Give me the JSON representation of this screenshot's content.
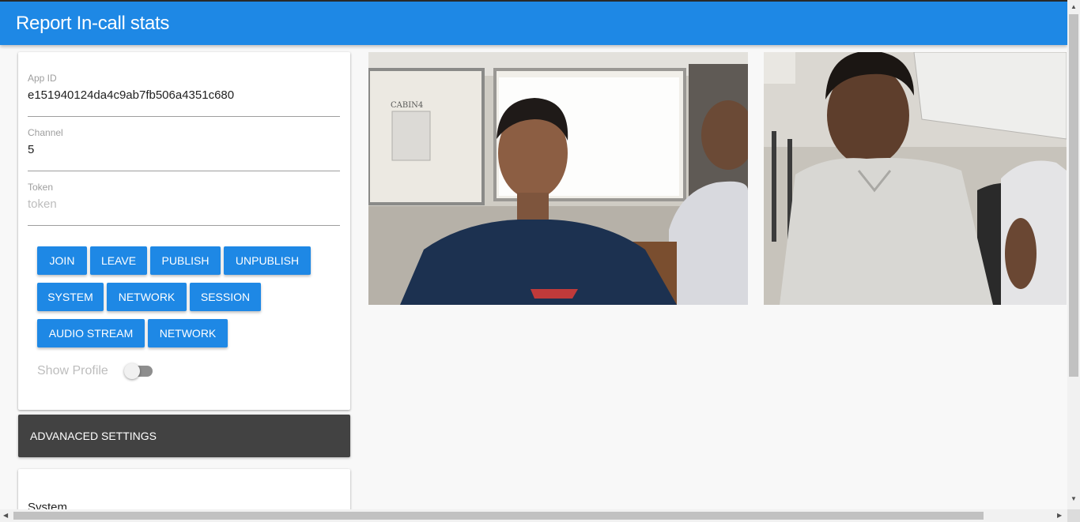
{
  "appbar": {
    "title": "Report In-call stats"
  },
  "form": {
    "app_id": {
      "label": "App ID",
      "value": "e151940124da4c9ab7fb506a4351c680"
    },
    "channel": {
      "label": "Channel",
      "value": "5"
    },
    "token": {
      "label": "Token",
      "value": "",
      "placeholder": "token"
    }
  },
  "buttons": {
    "join": "JOIN",
    "leave": "LEAVE",
    "publish": "PUBLISH",
    "unpublish": "UNPUBLISH",
    "system": "SYSTEM",
    "network": "NETWORK",
    "session": "SESSION",
    "audio_stream": "AUDIO STREAM",
    "network_2": "NETWORK"
  },
  "profile_toggle": {
    "label": "Show Profile",
    "enabled": false
  },
  "advanced": {
    "label": "ADVANACED SETTINGS"
  },
  "stats_card": {
    "heading": "System"
  },
  "videos": [
    {
      "name": "local-video-stream",
      "icon": "person-video-feed"
    },
    {
      "name": "remote-video-stream",
      "icon": "person-video-feed"
    }
  ],
  "colors": {
    "primary": "#1e88e5",
    "advanced_bg": "#424242"
  }
}
